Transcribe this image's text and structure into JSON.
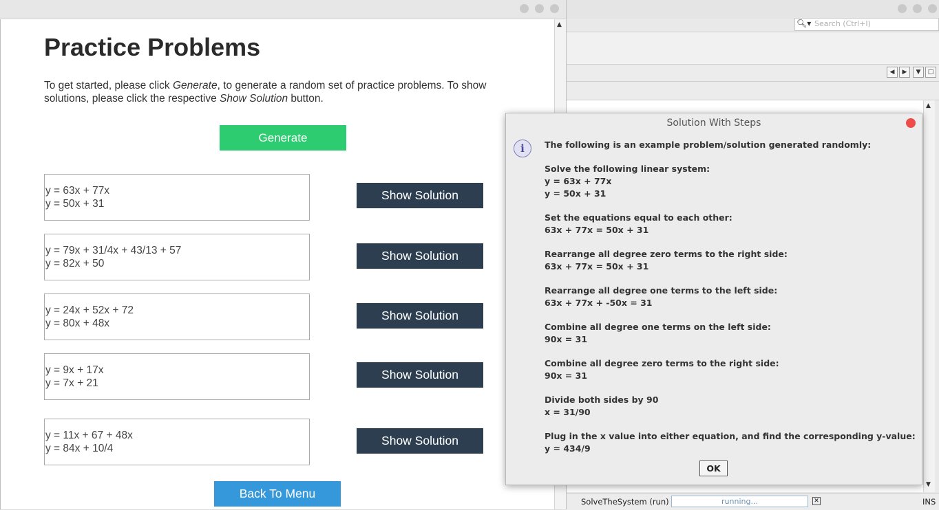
{
  "ide": {
    "search_placeholder": "Search (Ctrl+I)",
    "status": {
      "project": "SolveTheSystem (run)",
      "progress_text": "running...",
      "close": "✕",
      "mode": "INS"
    }
  },
  "app": {
    "title": "Practice Problems",
    "intro": {
      "part1": "To get started, please click ",
      "generate_ref": "Generate",
      "part2": ", to generate a random set of practice problems. To show solutions, please click the respective ",
      "show_ref": "Show Solution",
      "part3": " button."
    },
    "generate_label": "Generate",
    "problems": [
      {
        "eq1": "y = 63x + 77x",
        "eq2": "y = 50x + 31",
        "button": "Show Solution"
      },
      {
        "eq1": "y = 79x + 31/4x + 43/13 + 57",
        "eq2": "y = 82x + 50",
        "button": "Show Solution"
      },
      {
        "eq1": "y = 24x + 52x + 72",
        "eq2": "y = 80x + 48x",
        "button": "Show Solution"
      },
      {
        "eq1": "y = 9x + 17x",
        "eq2": "y = 7x + 21",
        "button": "Show Solution"
      },
      {
        "eq1": "y = 11x + 67 + 48x",
        "eq2": "y = 84x + 10/4",
        "button": "Show Solution"
      }
    ],
    "back_label": "Back To Menu"
  },
  "dialog": {
    "title": "Solution With Steps",
    "icon": "info-icon",
    "intro": "The following is an example problem/solution generated randomly:",
    "steps": [
      {
        "heading": "Solve the following linear system:",
        "lines": [
          "y = 63x + 77x",
          "y = 50x + 31"
        ]
      },
      {
        "heading": "Set the equations equal to each other:",
        "lines": [
          "63x + 77x = 50x + 31"
        ]
      },
      {
        "heading": "Rearrange all degree zero terms to the right side:",
        "lines": [
          "63x + 77x = 50x + 31"
        ]
      },
      {
        "heading": "Rearrange all degree one terms to the left side:",
        "lines": [
          "63x + 77x + -50x = 31"
        ]
      },
      {
        "heading": "Combine all degree one terms on the left side:",
        "lines": [
          "90x = 31"
        ]
      },
      {
        "heading": "Combine all degree zero terms to the right side:",
        "lines": [
          "90x = 31"
        ]
      },
      {
        "heading": "Divide both sides by 90",
        "lines": [
          "x = 31/90"
        ]
      },
      {
        "heading": "Plug in the x value into either equation, and find the corresponding y-value:",
        "lines": [
          "y = 434/9"
        ]
      }
    ],
    "ok_label": "OK"
  }
}
